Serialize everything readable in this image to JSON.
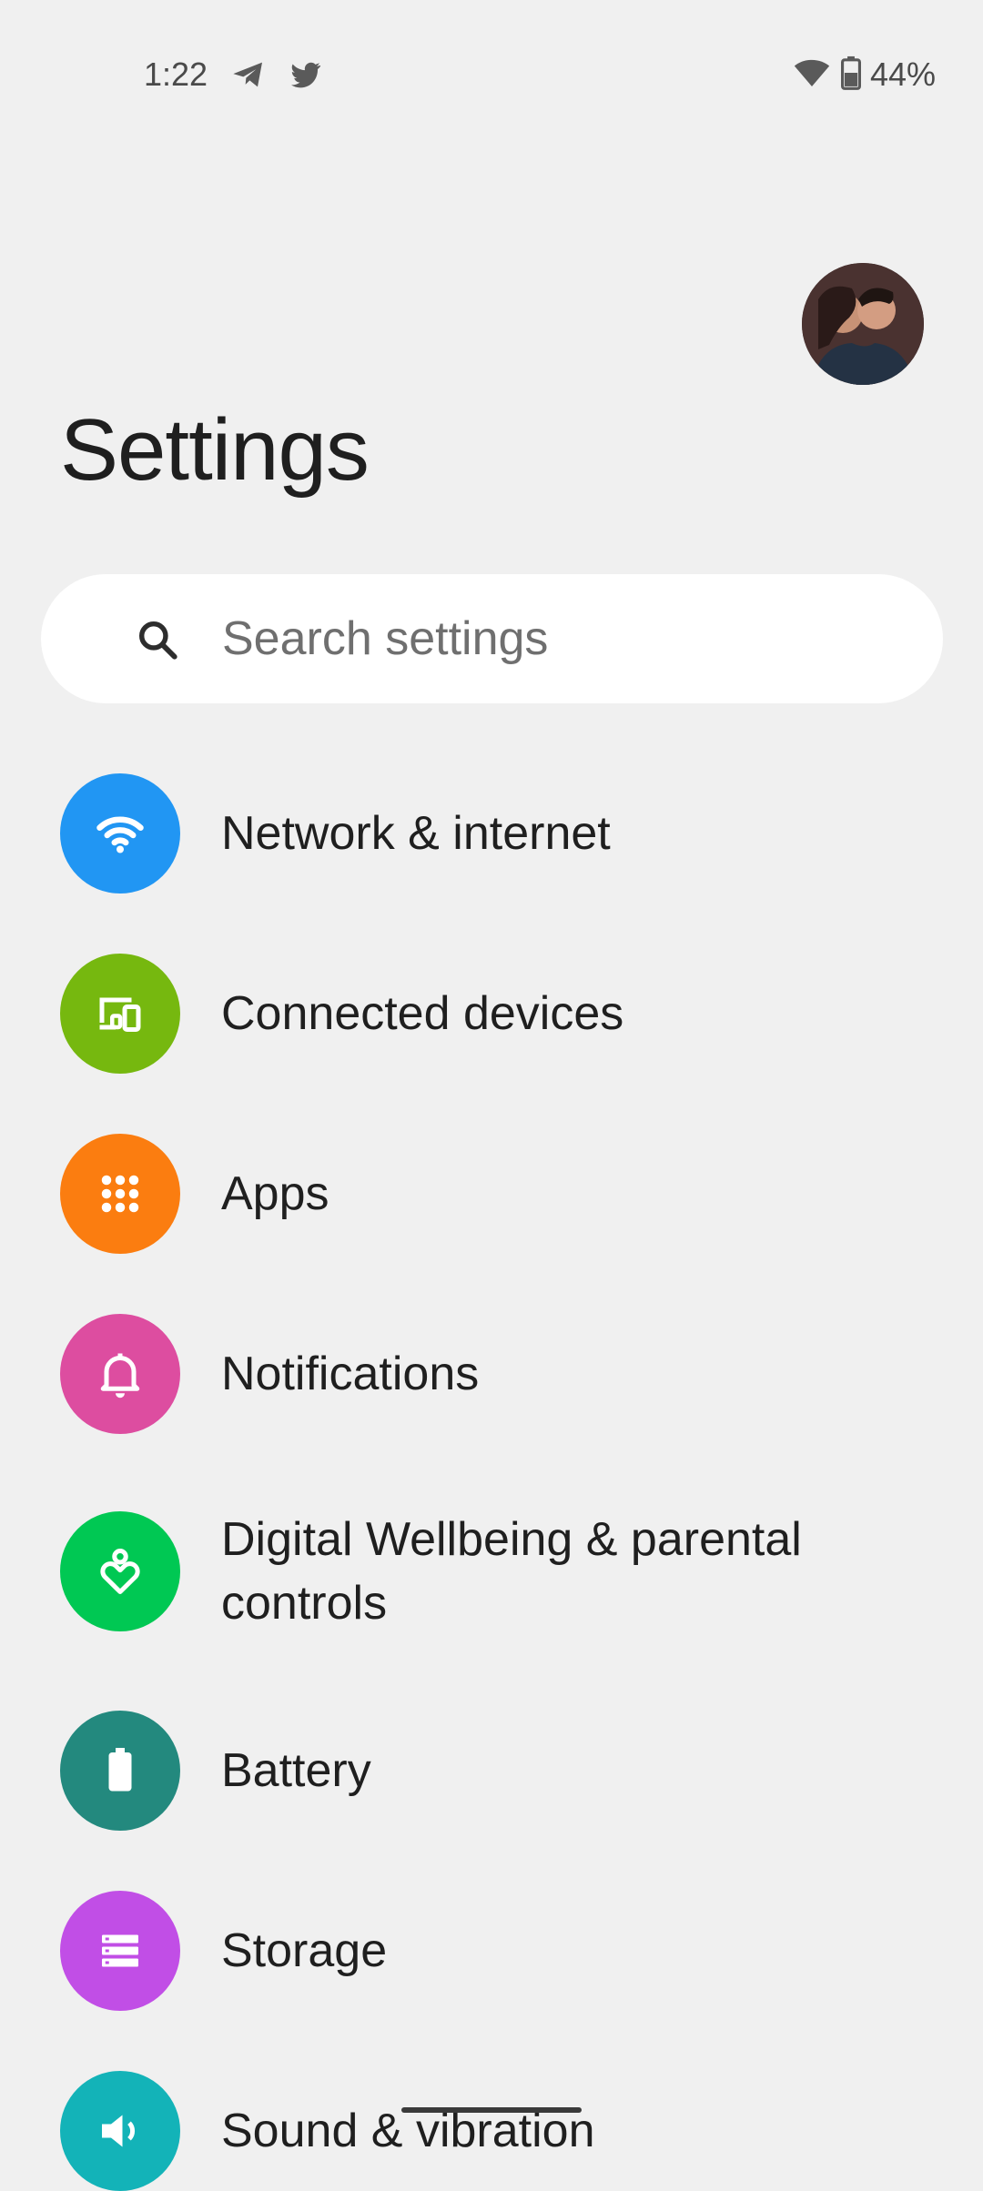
{
  "status_bar": {
    "time": "1:22",
    "battery_percent": "44%",
    "notification_icons": [
      "telegram-icon",
      "twitter-icon"
    ],
    "system_icons": [
      "wifi-icon",
      "battery-icon"
    ]
  },
  "header": {
    "title": "Settings"
  },
  "search": {
    "placeholder": "Search settings"
  },
  "settings_items": [
    {
      "label": "Network & internet",
      "icon": "wifi-icon",
      "color": "#2196f3"
    },
    {
      "label": "Connected devices",
      "icon": "devices-icon",
      "color": "#76b80f"
    },
    {
      "label": "Apps",
      "icon": "apps-grid-icon",
      "color": "#fb7d10"
    },
    {
      "label": "Notifications",
      "icon": "bell-icon",
      "color": "#dd4da0"
    },
    {
      "label": "Digital Wellbeing & parental controls",
      "icon": "wellbeing-icon",
      "color": "#00c853"
    },
    {
      "label": "Battery",
      "icon": "battery-icon",
      "color": "#23897e"
    },
    {
      "label": "Storage",
      "icon": "storage-icon",
      "color": "#c14ee6"
    },
    {
      "label": "Sound & vibration",
      "icon": "volume-icon",
      "color": "#13b3b8"
    }
  ]
}
